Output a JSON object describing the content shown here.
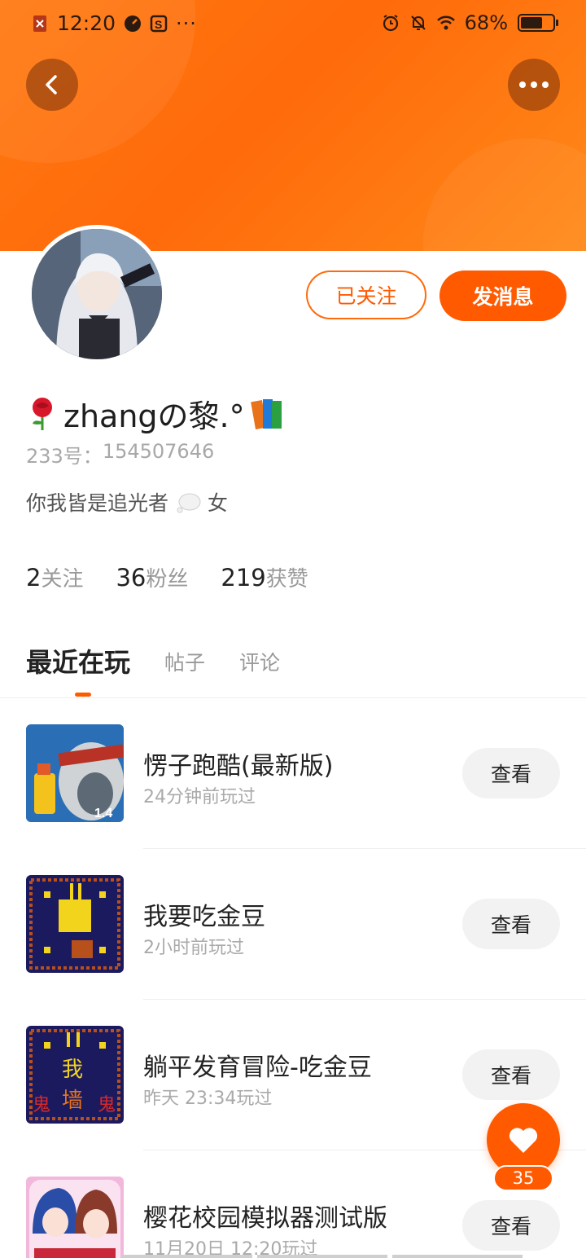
{
  "status_bar": {
    "time": "12:20",
    "dots": "···",
    "battery_percent": "68%",
    "battery_level": 0.68
  },
  "profile": {
    "username": "zhangの黎.°",
    "id_label": "233号：",
    "id_value": "154507646",
    "bio": "你我皆是追光者",
    "bio_suffix": "女",
    "follow_state_label": "已关注",
    "message_label": "发消息"
  },
  "stats": [
    {
      "value": "2",
      "label": "关注"
    },
    {
      "value": "36",
      "label": "粉丝"
    },
    {
      "value": "219",
      "label": "获赞"
    }
  ],
  "tabs": [
    {
      "label": "最近在玩",
      "active": true
    },
    {
      "label": "帖子",
      "active": false
    },
    {
      "label": "评论",
      "active": false
    }
  ],
  "games": [
    {
      "title": "愣子跑酷(最新版)",
      "played": "24分钟前玩过",
      "action": "查看",
      "thumb_badge": "1.4"
    },
    {
      "title": "我要吃金豆",
      "played": "2小时前玩过",
      "action": "查看"
    },
    {
      "title": "躺平发育冒险-吃金豆",
      "played": "昨天 23:34玩过",
      "action": "查看",
      "thumb_text": [
        "我",
        "墙",
        "鬼",
        "鬼"
      ]
    },
    {
      "title": "樱花校园模拟器测试版",
      "played": "11月20日 12:20玩过",
      "action": "查看"
    }
  ],
  "like_fab": {
    "count": "35"
  },
  "colors": {
    "accent": "#ff5a00",
    "header": "#ff7a12"
  },
  "icons": [
    "back-arrow-icon",
    "more-dots-icon",
    "heart-icon",
    "rose-emoji",
    "books-emoji",
    "thought-bubble-emoji"
  ]
}
